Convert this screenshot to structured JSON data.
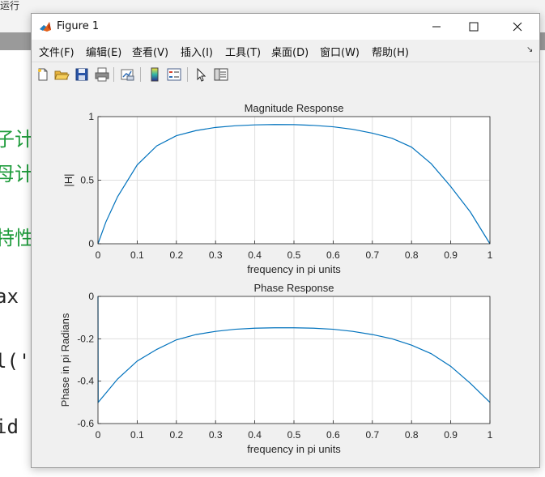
{
  "background": {
    "top_label": "运行",
    "code_lines": [
      {
        "text": "子计",
        "style": "green",
        "top": 152
      },
      {
        "text": "母计",
        "style": "green",
        "top": 195
      },
      {
        "text": "特性",
        "style": "green",
        "top": 274
      },
      {
        "text": "ax",
        "style": "black",
        "top": 352
      },
      {
        "text": "l('",
        "style": "black",
        "top": 432
      },
      {
        "text": "id",
        "style": "black",
        "top": 513
      }
    ]
  },
  "window": {
    "title": "Figure 1"
  },
  "menu": {
    "items": [
      "文件(F)",
      "编辑(E)",
      "查看(V)",
      "插入(I)",
      "工具(T)",
      "桌面(D)",
      "窗口(W)",
      "帮助(H)"
    ]
  },
  "toolbar": {
    "icons": [
      "new-figure-icon",
      "open-file-icon",
      "save-icon",
      "print-icon",
      "link-plot-icon",
      "insert-colorbar-icon",
      "insert-legend-icon",
      "pointer-icon",
      "property-inspector-icon"
    ]
  },
  "colors": {
    "line": "#0072bd",
    "grid": "#dfdfdf",
    "axes_bg": "#ffffff",
    "window_bg": "#f0f0f0"
  },
  "chart_data": [
    {
      "type": "line",
      "title": "Magnitude Response",
      "xlabel": "frequency in pi units",
      "ylabel": "|H|",
      "xlim": [
        0,
        1
      ],
      "ylim": [
        0,
        1
      ],
      "xticks": [
        0,
        0.1,
        0.2,
        0.3,
        0.4,
        0.5,
        0.6,
        0.7,
        0.8,
        0.9,
        1
      ],
      "yticks": [
        0,
        0.5,
        1
      ],
      "grid": true,
      "series": [
        {
          "x": [
            0,
            0.02,
            0.05,
            0.1,
            0.15,
            0.2,
            0.25,
            0.3,
            0.35,
            0.4,
            0.45,
            0.5,
            0.55,
            0.6,
            0.65,
            0.7,
            0.75,
            0.8,
            0.85,
            0.9,
            0.95,
            1
          ],
          "values": [
            0,
            0.17,
            0.37,
            0.62,
            0.77,
            0.85,
            0.89,
            0.915,
            0.928,
            0.935,
            0.938,
            0.937,
            0.931,
            0.92,
            0.9,
            0.87,
            0.83,
            0.76,
            0.63,
            0.45,
            0.25,
            0
          ]
        }
      ]
    },
    {
      "type": "line",
      "title": "Phase Response",
      "xlabel": "frequency in pi units",
      "ylabel": "Phase in pi Radians",
      "xlim": [
        0,
        1
      ],
      "ylim": [
        -0.6,
        0
      ],
      "xticks": [
        0,
        0.1,
        0.2,
        0.3,
        0.4,
        0.5,
        0.6,
        0.7,
        0.8,
        0.9,
        1
      ],
      "yticks": [
        -0.6,
        -0.4,
        -0.2,
        0
      ],
      "grid": true,
      "series": [
        {
          "x": [
            0,
            0.0005,
            0.05,
            0.1,
            0.15,
            0.2,
            0.25,
            0.3,
            0.35,
            0.4,
            0.45,
            0.5,
            0.55,
            0.6,
            0.65,
            0.7,
            0.75,
            0.8,
            0.85,
            0.9,
            0.95,
            1
          ],
          "values": [
            0,
            -0.5,
            -0.39,
            -0.305,
            -0.25,
            -0.205,
            -0.18,
            -0.165,
            -0.155,
            -0.15,
            -0.148,
            -0.148,
            -0.15,
            -0.155,
            -0.165,
            -0.18,
            -0.2,
            -0.23,
            -0.27,
            -0.33,
            -0.41,
            -0.5
          ]
        }
      ]
    }
  ]
}
